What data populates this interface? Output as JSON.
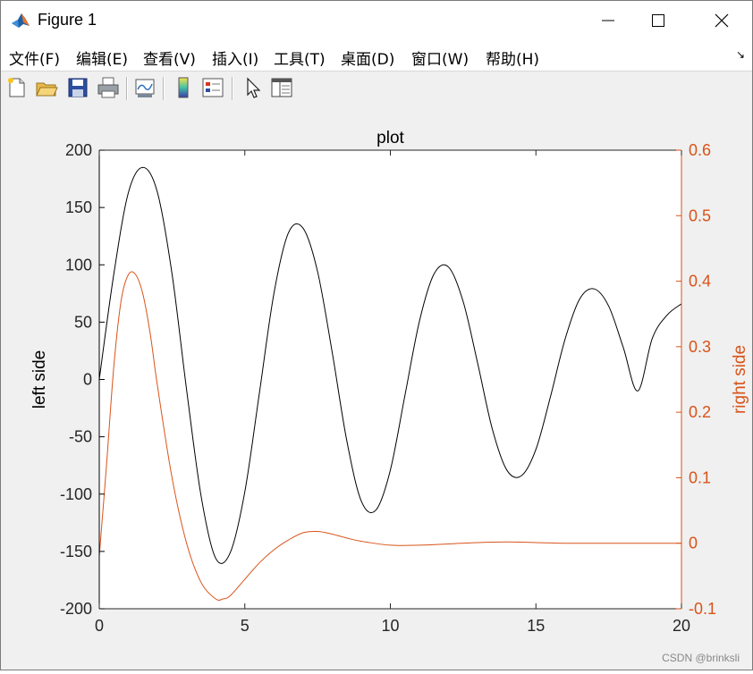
{
  "window": {
    "title": "Figure 1",
    "minimize_icon": "minimize-icon",
    "maximize_icon": "maximize-icon",
    "close_icon": "close-icon"
  },
  "menu": {
    "items": [
      "文件(F)",
      "编辑(E)",
      "查看(V)",
      "插入(I)",
      "工具(T)",
      "桌面(D)",
      "窗口(W)",
      "帮助(H)"
    ]
  },
  "toolbar": {
    "icons": [
      "new-figure-icon",
      "open-file-icon",
      "save-icon",
      "print-icon",
      "link-plot-icon",
      "insert-colorbar-icon",
      "insert-legend-icon",
      "edit-plot-arrow-icon",
      "property-inspector-icon"
    ]
  },
  "watermark": "CSDN @brinksli",
  "chart_data": {
    "type": "line",
    "title": "plot",
    "xlabel": "",
    "ylabel_left": "left side",
    "ylabel_right": "right side",
    "xlim": [
      0,
      20
    ],
    "ylim_left": [
      -200,
      200
    ],
    "ylim_right": [
      -0.1,
      0.6
    ],
    "x_ticks": [
      "0",
      "5",
      "10",
      "15",
      "20"
    ],
    "y_left_ticks": [
      "200",
      "150",
      "100",
      "50",
      "0",
      "-50",
      "-100",
      "-150",
      "-200"
    ],
    "y_right_ticks": [
      "0.6",
      "0.5",
      "0.4",
      "0.3",
      "0.2",
      "0.1",
      "0",
      "-0.1"
    ],
    "colors": {
      "left": "#000000",
      "right": "#D95319"
    },
    "series": [
      {
        "axis": "left",
        "color": "#000000",
        "x": [
          0,
          0.5,
          1.0,
          1.5,
          2.0,
          2.5,
          3.0,
          3.5,
          4.0,
          4.5,
          5.0,
          5.5,
          6.0,
          6.5,
          7.0,
          7.5,
          8.0,
          8.5,
          9.0,
          9.5,
          10.0,
          10.5,
          11.0,
          11.5,
          12.0,
          12.5,
          13.0,
          13.5,
          14.0,
          14.5,
          15.0,
          15.5,
          16.0,
          16.5,
          17.0,
          17.5,
          18.0,
          18.5,
          19.0,
          19.5,
          20.0
        ],
        "y": [
          0,
          92,
          163,
          185,
          163,
          92,
          -9,
          -102,
          -156,
          -151,
          -98,
          -12,
          75,
          128,
          132,
          94,
          24,
          -53,
          -106,
          -114,
          -79,
          -14,
          51,
          92,
          98,
          68,
          14,
          -43,
          -79,
          -84,
          -61,
          -15,
          35,
          70,
          79,
          64,
          28,
          -10,
          36,
          56,
          66
        ]
      },
      {
        "axis": "right",
        "color": "#D95319",
        "x": [
          0,
          0.25,
          0.5,
          0.75,
          1.0,
          1.25,
          1.5,
          1.75,
          2.0,
          2.5,
          3.0,
          3.5,
          4.0,
          4.25,
          4.5,
          5.0,
          5.5,
          6.0,
          6.5,
          7.0,
          7.5,
          8.0,
          8.5,
          9.0,
          10.0,
          11.0,
          12.0,
          13.0,
          14.0,
          15.0,
          16.0,
          17.0,
          18.0,
          19.0,
          20.0
        ],
        "y": [
          -0.02,
          0.12,
          0.27,
          0.37,
          0.41,
          0.41,
          0.38,
          0.32,
          0.24,
          0.1,
          0.0,
          -0.06,
          -0.085,
          -0.085,
          -0.08,
          -0.055,
          -0.03,
          -0.01,
          0.005,
          0.016,
          0.018,
          0.014,
          0.008,
          0.003,
          -0.003,
          -0.003,
          -0.001,
          0.001,
          0.002,
          0.001,
          0.0,
          0.0,
          0.0,
          0.0,
          0.0
        ]
      }
    ]
  }
}
